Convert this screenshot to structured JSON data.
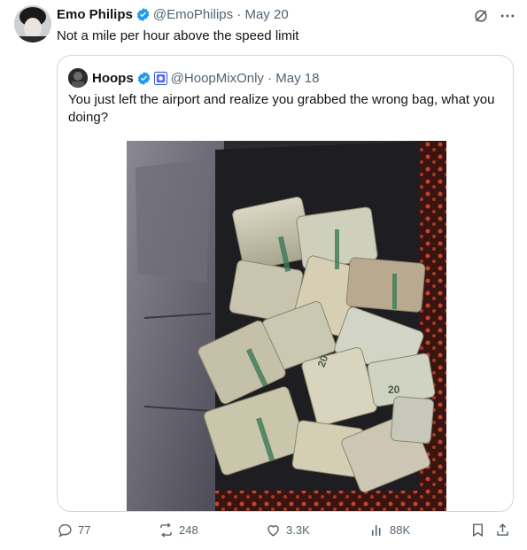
{
  "tweet": {
    "author_name": "Emo Philips",
    "handle": "@EmoPhilips",
    "date": "May 20",
    "text": "Not a mile per hour above the speed limit"
  },
  "quote": {
    "author_name": "Hoops",
    "handle": "@HoopMixOnly",
    "date": "May 18",
    "text": "You just left the airport and realize you grabbed the wrong bag, what you doing?",
    "image_alt_visible_text": "20"
  },
  "actions": {
    "replies": "77",
    "reposts": "248",
    "likes": "3.3K",
    "views": "88K"
  },
  "colors": {
    "verified_blue": "#1d9bf0",
    "muted": "#536471",
    "border": "#cfd9de"
  },
  "icons": [
    "verified-icon",
    "grok-icon",
    "more-icon",
    "affiliate-badge-icon",
    "reply-icon",
    "repost-icon",
    "like-icon",
    "views-icon",
    "bookmark-icon",
    "share-icon"
  ]
}
